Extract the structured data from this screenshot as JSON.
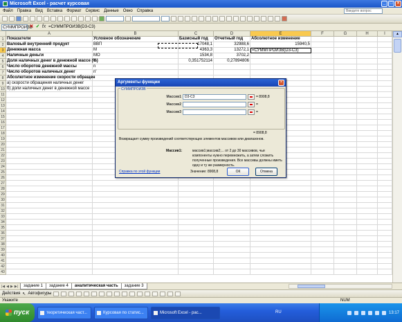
{
  "window": {
    "title": "Microsoft Excel - расчет курсовая"
  },
  "menu": [
    "Файл",
    "Правка",
    "Вид",
    "Вставка",
    "Формат",
    "Сервис",
    "Данные",
    "Окно",
    "Справка"
  ],
  "help_box": {
    "placeholder": "Введите вопрос"
  },
  "formula_bar": {
    "name_box": "СУММПРОИЗВ",
    "formula": "=СУММПРОИЗВ(D3-C3)",
    "fx": "fx"
  },
  "columns": [
    "A",
    "B",
    "C",
    "D",
    "E",
    "F",
    "G",
    "H",
    "I"
  ],
  "selected_column": "E",
  "selected_row": 3,
  "rows": [
    {
      "n": 1,
      "a": "Показатели",
      "b": "Условное обозначение",
      "c": "Базисный год",
      "d": "Отчетный год",
      "e": "Абсолютное изменение",
      "bold": true
    },
    {
      "n": 2,
      "a": "Валовый внутренний продукт",
      "b": "ВВП",
      "c": "17048,1",
      "d": "32988,6",
      "e": "15940,5",
      "bold_a": true
    },
    {
      "n": 3,
      "a": "Денежная масса",
      "b": "M",
      "c": "4363,3",
      "d": "13272,1",
      "e": "=СУММПРОИЗВ(D3-C3)",
      "bold_a": true
    },
    {
      "n": 4,
      "a": "Наличные деньги",
      "b": "MO",
      "c": "1534,8",
      "d": "3702,2",
      "e": "",
      "bold_a": true
    },
    {
      "n": 5,
      "a": "Доля наличных денег в денежной массе (%)",
      "b": "d",
      "c": "0,351752114",
      "d": "0,27894806",
      "e": "",
      "bold_a": true
    },
    {
      "n": 6,
      "a": "Число оборотов денежной массы",
      "b": "n",
      "c": "",
      "d": "",
      "e": "",
      "bold_a": true
    },
    {
      "n": 7,
      "a": "Число оборотов наличных денег",
      "b": "n'",
      "c": "",
      "d": "",
      "e": "",
      "bold_a": true
    },
    {
      "n": 8,
      "a": "   Абсолютное изменение скорости обращен",
      "b": "",
      "c": "",
      "d": "",
      "e": "",
      "bold_a": true
    },
    {
      "n": 9,
      "a": "а) скорости обращения наличных денег",
      "b": "",
      "c": "",
      "d": "",
      "e": ""
    },
    {
      "n": 10,
      "a": "б) доли наличных денег в денежной массе",
      "b": "",
      "c": "",
      "d": "",
      "e": ""
    }
  ],
  "empty_row_count": 33,
  "dialog": {
    "title": "Аргументы функции",
    "function_name": "СУММПРОИЗВ",
    "args": [
      {
        "label": "Массив1",
        "value": "D3-C3",
        "result": "= 8908,8"
      },
      {
        "label": "Массив2",
        "value": "",
        "result": "= "
      },
      {
        "label": "Массив3",
        "value": "",
        "result": "= "
      }
    ],
    "total": "= 8908,8",
    "description": "Возвращает сумму произведений соответствующих элементов массивов или диапазонов.",
    "arg_key": "Массив1:",
    "arg_text": "массив1;массив2;... от 2 до 30 массивов, чьи компоненты нужно перемножить, а затем сложить полученные произведения. Все массивы должны иметь одну и ту же размерность.",
    "help_link": "Справка по этой функции",
    "value_label": "Значение: 8908,8",
    "ok": "ОК",
    "cancel": "Отмена"
  },
  "sheet_tabs": [
    "задание 1",
    "задание 4",
    "аналитическая часть",
    "задание 3"
  ],
  "active_tab": "аналитическая часть",
  "draw_bar": {
    "actions": "Действия",
    "autoshapes": "Автофигуры"
  },
  "status": {
    "mode": "Укажите",
    "num": "NUM"
  },
  "taskbar": {
    "start": "пуск",
    "tasks": [
      "теоретическая част...",
      "Курсовая по статис...",
      "Microsoft Excel - рас..."
    ],
    "active_task": 2,
    "lang": "RU",
    "clock": "13:17"
  },
  "colors": {
    "title_blue": "#1a56c9",
    "selection": "#f9c94f",
    "taskbar": "#245edb",
    "start_green": "#2f8a2d"
  }
}
